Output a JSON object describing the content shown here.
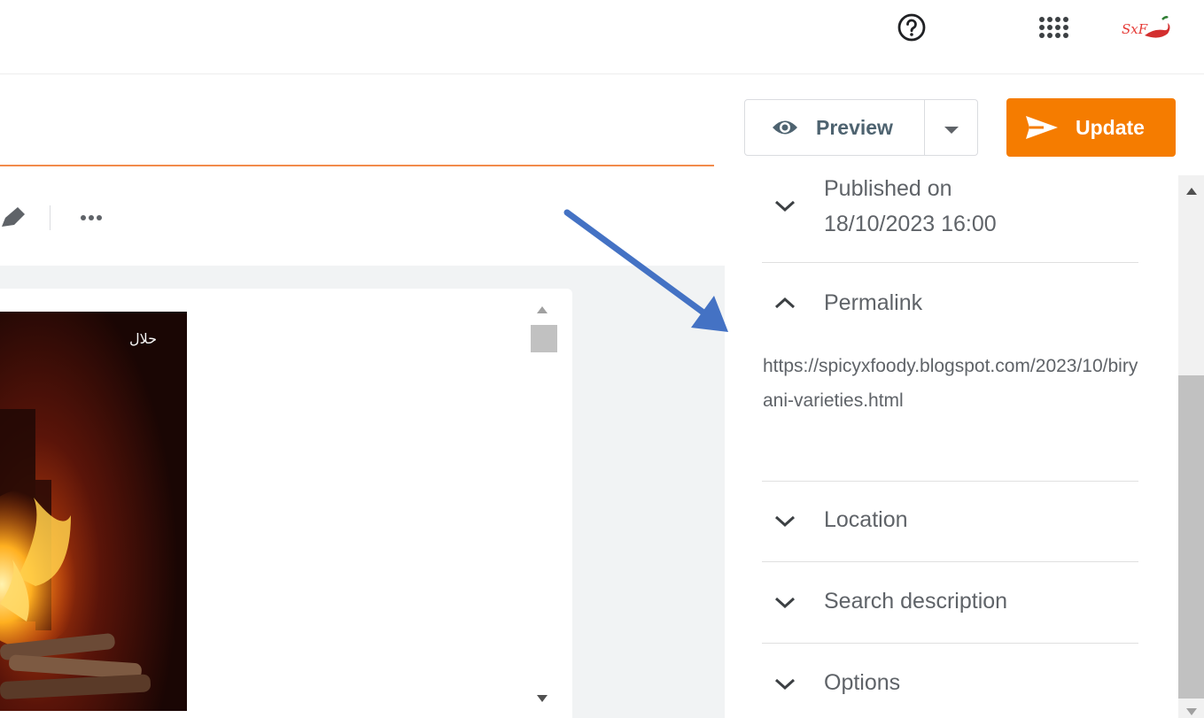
{
  "topbar": {
    "help_icon": "help-circle-icon",
    "apps_icon": "apps-grid-icon",
    "avatar_text": "SxF"
  },
  "actions": {
    "preview_label": "Preview",
    "update_label": "Update",
    "accent_color": "#f57c00",
    "preview_text_color": "#4e6370"
  },
  "toolbar": {
    "icons": [
      "pen-icon",
      "more-horizontal-icon"
    ]
  },
  "post_image": {
    "badge_text": "حلال"
  },
  "sidebar": {
    "sections": [
      {
        "key": "published",
        "title": "Published on 18/10/2023 16:00",
        "title_line1": "Published on",
        "title_line2": "18/10/2023 16:00",
        "expanded": false
      },
      {
        "key": "permalink",
        "title": "Permalink",
        "expanded": true,
        "url": "https://spicyxfoody.blogspot.com/2023/10/biryani-varieties.html"
      },
      {
        "key": "location",
        "title": "Location",
        "expanded": false
      },
      {
        "key": "search_description",
        "title": "Search description",
        "expanded": false
      },
      {
        "key": "options",
        "title": "Options",
        "expanded": false
      }
    ]
  },
  "annotation": {
    "arrow_color": "#4472c4"
  }
}
